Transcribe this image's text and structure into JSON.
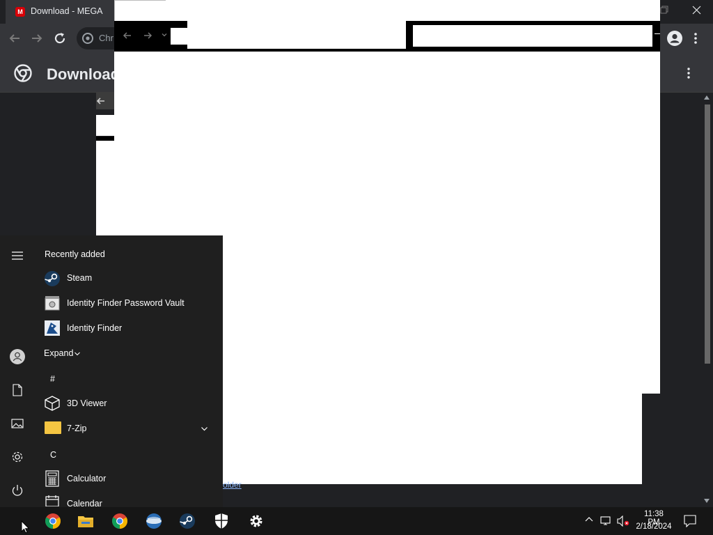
{
  "browser": {
    "tab_title": "Download - MEGA",
    "tab_favicon": "M",
    "omnibox_text": "Chr",
    "page_title": "Download"
  },
  "downloads": {
    "folder_link": "older"
  },
  "start_menu": {
    "recently_added": "Recently added",
    "recent_apps": [
      {
        "label": "Steam",
        "icon": "steam-icon"
      },
      {
        "label": "Identity Finder Password Vault",
        "icon": "vault-icon"
      },
      {
        "label": "Identity Finder",
        "icon": "identity-finder-icon"
      }
    ],
    "expand_label": "Expand",
    "group_hash": "#",
    "apps_hash": [
      {
        "label": "3D Viewer",
        "icon": "cube-icon"
      },
      {
        "label": "7-Zip",
        "icon": "folder-icon"
      }
    ],
    "group_c": "C",
    "apps_c": [
      {
        "label": "Calculator",
        "icon": "calculator-icon"
      },
      {
        "label": "Calendar",
        "icon": "calendar-icon"
      }
    ]
  },
  "taskbar": {
    "pinned": [
      "chrome-icon",
      "file-explorer-icon",
      "chrome-icon",
      "globe-app-icon",
      "steam-icon",
      "windows-security-icon",
      "settings-icon"
    ],
    "time": "11:38 PM",
    "date": "2/18/2024"
  },
  "colors": {
    "background": "#202124",
    "start_menu": "#1f1f1f",
    "taskbar": "#161616",
    "mega_red": "#d90007",
    "link": "#8ab4f8"
  }
}
